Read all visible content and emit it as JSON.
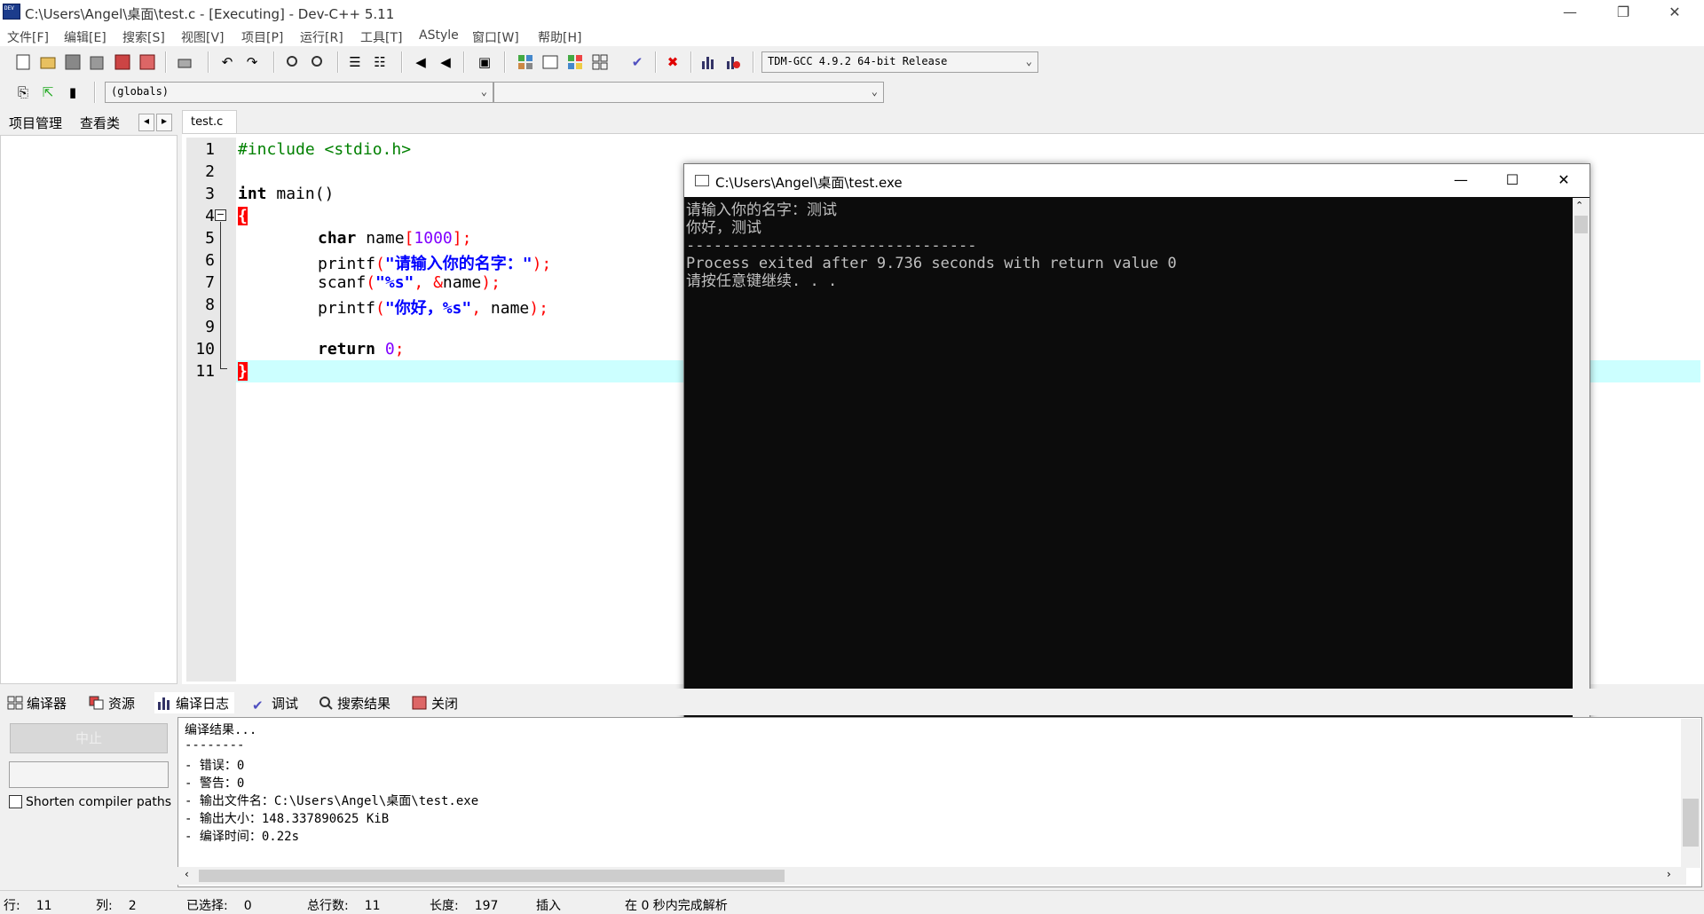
{
  "window": {
    "title": "C:\\Users\\Angel\\桌面\\test.c - [Executing] - Dev-C++ 5.11",
    "minimize": "—",
    "restore": "❐",
    "close": "✕"
  },
  "menu": [
    "文件[F]",
    "编辑[E]",
    "搜索[S]",
    "视图[V]",
    "项目[P]",
    "运行[R]",
    "工具[T]",
    "AStyle",
    "窗口[W]",
    "帮助[H]"
  ],
  "toolbar": {
    "compiler_select": "TDM-GCC 4.9.2 64-bit Release",
    "scope_select": "(globals)",
    "member_select": ""
  },
  "left_panel": {
    "tabs": [
      "项目管理",
      "查看类"
    ],
    "nav_prev": "◂",
    "nav_next": "▸"
  },
  "editor": {
    "tab": "test.c",
    "line_numbers": [
      "1",
      "2",
      "3",
      "4",
      "5",
      "6",
      "7",
      "8",
      "9",
      "10",
      "11"
    ],
    "lines": {
      "l1": "#include <stdio.h>",
      "l3_kw": "int",
      "l3_rest": " main()",
      "l4": "{",
      "l5_kw": "char",
      "l5_rest": " name",
      "l5_open": "[",
      "l5_num": "1000",
      "l5_close": "];",
      "l6_fn": "printf",
      "l6_open": "(",
      "l6_str": "\"请输入你的名字：\"",
      "l6_close": ");",
      "l7_fn": "scanf",
      "l7_open": "(",
      "l7_str": "\"%s\"",
      "l7_comma": ", ",
      "l7_amp": "&",
      "l7_var": "name",
      "l7_close": ");",
      "l8_fn": "printf",
      "l8_open": "(",
      "l8_str": "\"你好，%s\"",
      "l8_comma": ", ",
      "l8_var": "name",
      "l8_close": ");",
      "l10_kw": "return",
      "l10_num": "0",
      "l10_end": ";",
      "l11": "}"
    }
  },
  "console": {
    "title": "C:\\Users\\Angel\\桌面\\test.exe",
    "lines": [
      "请输入你的名字：测试",
      "你好，测试",
      "--------------------------------",
      "Process exited after 9.736 seconds with return value 0",
      "请按任意键继续. . ."
    ]
  },
  "bottom_tabs": [
    "编译器",
    "资源",
    "编译日志",
    "调试",
    "搜索结果",
    "关闭"
  ],
  "bottom_left": {
    "stop_label": "中止",
    "shorten_label": "Shorten compiler paths"
  },
  "output": [
    "编译结果...",
    "--------",
    "- 错误：0",
    "- 警告：0",
    "- 输出文件名：C:\\Users\\Angel\\桌面\\test.exe",
    "- 输出大小：148.337890625 KiB",
    "- 编译时间：0.22s"
  ],
  "status": {
    "row_label": "行:",
    "row_value": "11",
    "col_label": "列:",
    "col_value": "2",
    "sel_label": "已选择:",
    "sel_value": "0",
    "total_label": "总行数:",
    "total_value": "11",
    "len_label": "长度:",
    "len_value": "197",
    "mode": "插入",
    "parse": "在 0 秒内完成解析"
  }
}
